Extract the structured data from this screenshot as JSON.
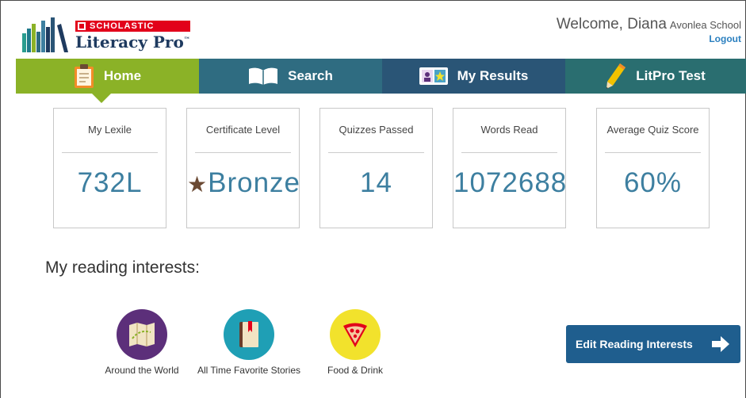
{
  "header": {
    "brand_tag": "SCHOLASTIC",
    "brand_name": "Literacy Pro",
    "trademark": "™",
    "welcome": "Welcome, Diana",
    "school": "Avonlea School",
    "logout": "Logout"
  },
  "nav": {
    "tabs": [
      {
        "label": "Home",
        "icon": "clipboard-icon",
        "active": true
      },
      {
        "label": "Search",
        "icon": "book-icon"
      },
      {
        "label": "My Results",
        "icon": "results-icon"
      },
      {
        "label": "LitPro Test",
        "icon": "pencil-icon"
      }
    ]
  },
  "stats": [
    {
      "label": "My Lexile",
      "value": "732L"
    },
    {
      "label": "Certificate Level",
      "value": "Bronze",
      "icon": "star-icon"
    },
    {
      "label": "Quizzes Passed",
      "value": "14"
    },
    {
      "label": "Words Read",
      "value": "1072688"
    },
    {
      "label": "Average Quiz Score",
      "value": "60%"
    }
  ],
  "interests": {
    "title": "My reading interests:",
    "items": [
      {
        "label": "Around the World",
        "icon": "map-icon",
        "color": "#5c2f7a"
      },
      {
        "label": "All Time Favorite Stories",
        "icon": "book-icon",
        "color": "#1f9fb5"
      },
      {
        "label": "Food & Drink",
        "icon": "pizza-icon",
        "color": "#f2e22c"
      }
    ],
    "edit_button": "Edit Reading Interests"
  },
  "colors": {
    "home_tab": "#8bb227",
    "search_tab": "#2f6c81",
    "results_tab": "#2a5576",
    "test_tab": "#2a6e70",
    "stat_value": "#3d7fa0",
    "button": "#1f5e8e"
  }
}
